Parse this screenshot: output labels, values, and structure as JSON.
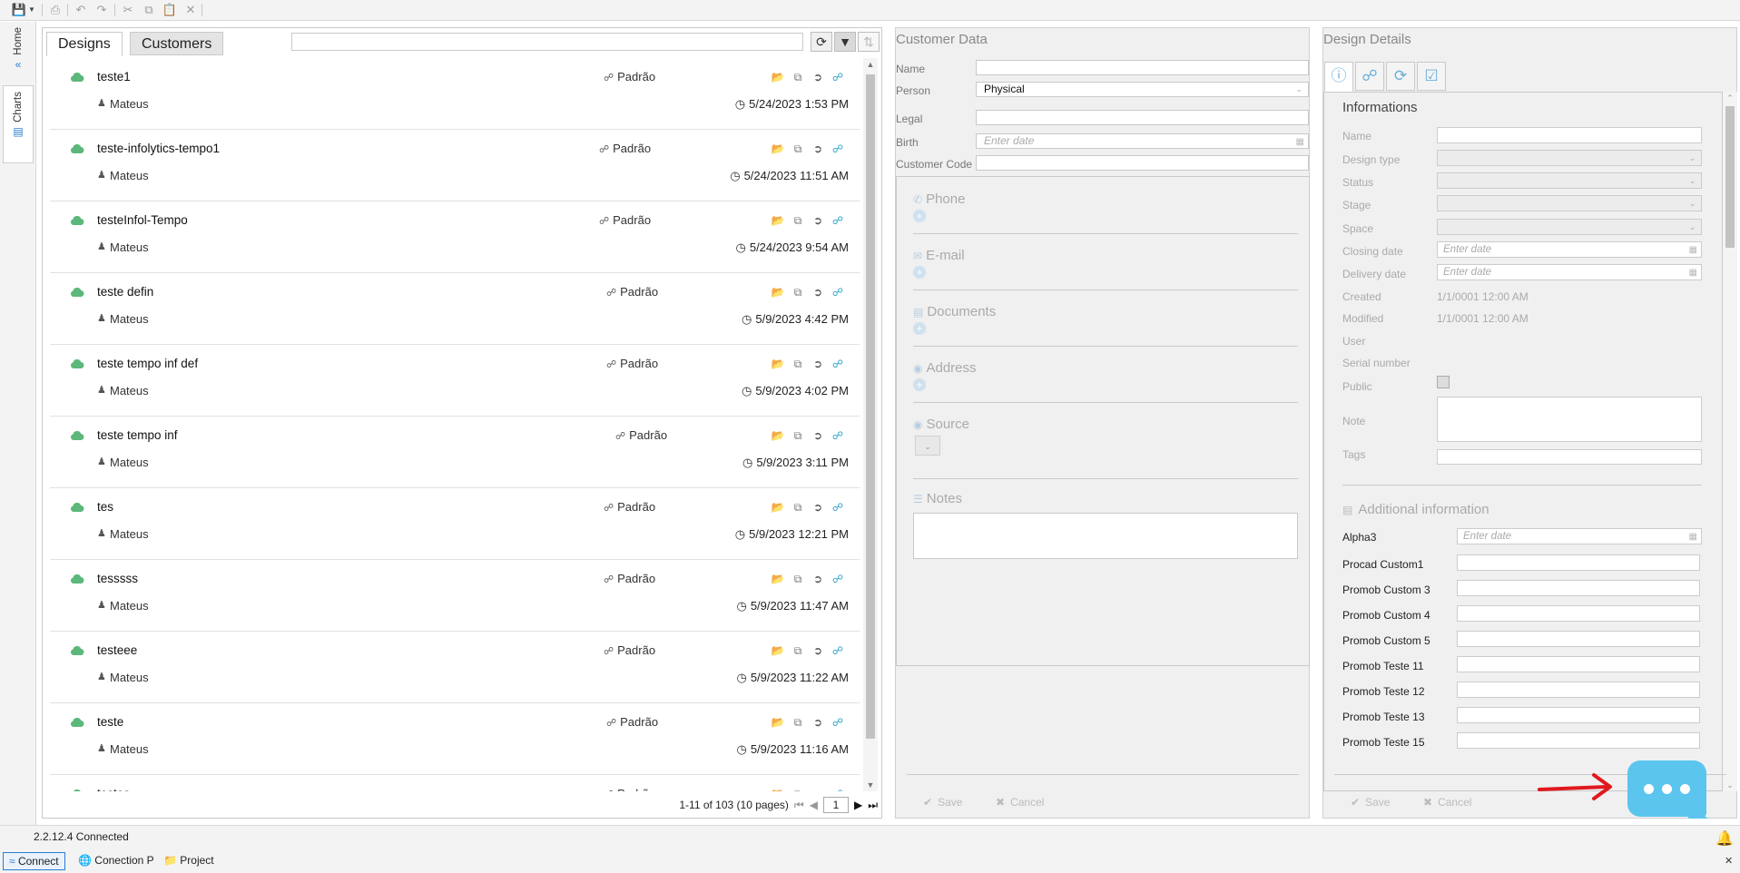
{
  "version": "2.2.12.4",
  "connection_status": "Connected",
  "rail_tabs": [
    "Home",
    "Charts"
  ],
  "designs_panel": {
    "tabs": [
      "Designs",
      "Customers"
    ],
    "search_placeholder": "",
    "pager": {
      "summary": "1-11 of 103 (10 pages)",
      "current_page": "1"
    },
    "rows": [
      {
        "title": "teste1",
        "template": "Padrão",
        "user": "Mateus",
        "date": "5/24/2023 1:53 PM"
      },
      {
        "title": "teste-infolytics-tempo1",
        "template": "Padrão",
        "user": "Mateus",
        "date": "5/24/2023 11:51 AM"
      },
      {
        "title": "testeInfol-Tempo",
        "template": "Padrão",
        "user": "Mateus",
        "date": "5/24/2023 9:54 AM"
      },
      {
        "title": "teste defin",
        "template": "Padrão",
        "user": "Mateus",
        "date": "5/9/2023 4:42 PM"
      },
      {
        "title": "teste tempo inf def",
        "template": "Padrão",
        "user": "Mateus",
        "date": "5/9/2023 4:02 PM"
      },
      {
        "title": "teste tempo inf",
        "template": "Padrão",
        "user": "Mateus",
        "date": "5/9/2023 3:11 PM"
      },
      {
        "title": "tes",
        "template": "Padrão",
        "user": "Mateus",
        "date": "5/9/2023 12:21 PM"
      },
      {
        "title": "tesssss",
        "template": "Padrão",
        "user": "Mateus",
        "date": "5/9/2023 11:47 AM"
      },
      {
        "title": "testeee",
        "template": "Padrão",
        "user": "Mateus",
        "date": "5/9/2023 11:22 AM"
      },
      {
        "title": "teste",
        "template": "Padrão",
        "user": "Mateus",
        "date": "5/9/2023 11:16 AM"
      },
      {
        "title": "testes",
        "template": "Padrão",
        "user": "",
        "date": ""
      }
    ]
  },
  "customer_panel": {
    "title": "Customer Data",
    "fields": {
      "name_label": "Name",
      "person_label": "Person",
      "person_value": "Physical",
      "legal_label": "Legal",
      "birth_label": "Birth",
      "birth_placeholder": "Enter date",
      "code_label": "Customer Code"
    },
    "sections": [
      "Phone",
      "E-mail",
      "Documents",
      "Address",
      "Source",
      "Notes"
    ],
    "save_label": "Save",
    "cancel_label": "Cancel"
  },
  "details_panel": {
    "title": "Design Details",
    "info_title": "Informations",
    "fields": {
      "name": "Name",
      "design_type": "Design type",
      "status": "Status",
      "stage": "Stage",
      "space": "Space",
      "closing_date": "Closing date",
      "delivery_date": "Delivery date",
      "created": "Created",
      "modified": "Modified",
      "user": "User",
      "serial": "Serial number",
      "public": "Public",
      "note": "Note",
      "tags": "Tags"
    },
    "date_placeholder": "Enter date",
    "created_value": "1/1/0001 12:00 AM",
    "modified_value": "1/1/0001 12:00 AM",
    "additional_title": "Additional information",
    "additional_fields": [
      "Alpha3",
      "Procad Custom1",
      "Promob Custom 3",
      "Promob Custom 4",
      "Promob Custom 5",
      "Promob Teste 11",
      "Promob Teste 12",
      "Promob Teste 13",
      "Promob Teste 15"
    ],
    "save_label": "Save",
    "cancel_label": "Cancel"
  },
  "taskbar": [
    "Connect",
    "Conection P",
    "Project"
  ],
  "colors": {
    "cloud": "#5cb87a",
    "accent": "#2aa3c9",
    "folder": "#e3a94a",
    "arrow": "#e0191d",
    "chat": "#5bc5ee"
  }
}
